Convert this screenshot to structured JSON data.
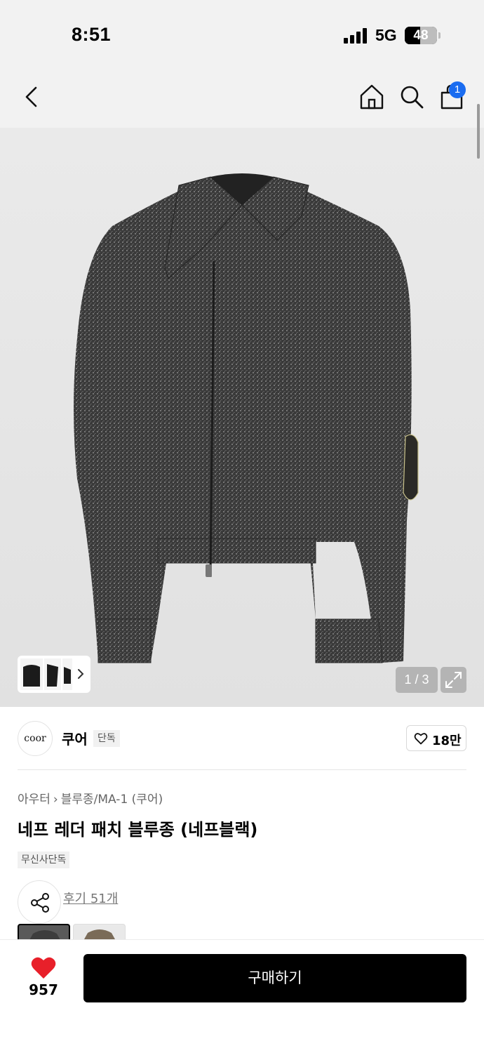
{
  "status_bar": {
    "time": "8:51",
    "network": "5G",
    "battery": "48",
    "battery_level": 0.48
  },
  "nav": {
    "cart_count": "1",
    "icons": [
      "back-icon",
      "home-icon",
      "search-icon",
      "cart-icon"
    ]
  },
  "gallery": {
    "page_indicator": "1 / 3"
  },
  "brand": {
    "logo_text": "coor",
    "name": "쿠어",
    "tag": "단독",
    "like_count": "18만"
  },
  "product": {
    "breadcrumb": [
      "아우터",
      "블루종/MA-1 (쿠어)"
    ],
    "title": "네프 레더 패치 블루종 (네프블랙)",
    "badge": "무신사단독",
    "review_link": "후기 51개"
  },
  "bottom_bar": {
    "heart_count": "957",
    "buy_label": "구매하기"
  },
  "colors": {
    "accent_blue": "#1a6cf0",
    "heart_red": "#e8202a",
    "button_black": "#000000"
  }
}
